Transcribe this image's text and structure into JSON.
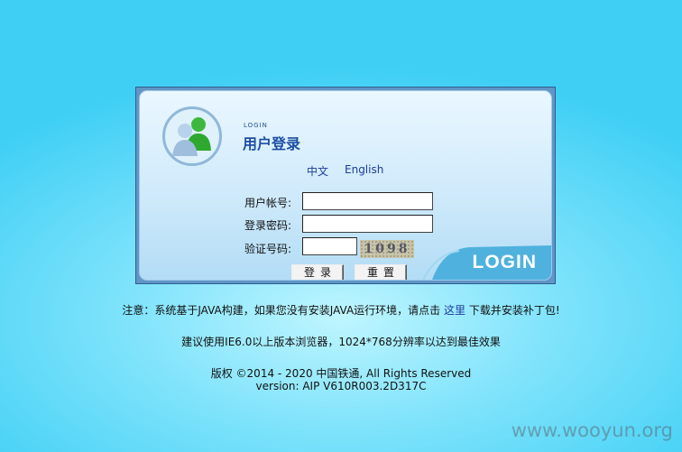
{
  "panel": {
    "login_small": "LOGIN",
    "title": "用户登录",
    "lang_zh": "中文",
    "lang_en": "English",
    "fields": {
      "username_label": "用户帐号:",
      "password_label": "登录密码:",
      "captcha_label": "验证号码:",
      "username_value": "",
      "password_value": "",
      "captcha_value": ""
    },
    "captcha_text": "1098",
    "login_button": "登录",
    "reset_button": "重置",
    "corner_text": "LOGIN"
  },
  "notice": {
    "prefix": "注意：系统基于JAVA构建，如果您没有安装JAVA运行环境，请点击",
    "link": "这里",
    "suffix": "下载并安装补丁包!"
  },
  "recommend": "建议使用IE6.0以上版本浏览器，1024*768分辨率以达到最佳效果",
  "copyright": "版权 ©2014 - 2020 中国铁通, All Rights Reserved",
  "version": "version: AIP V610R003.2D317C",
  "watermark": "www.wooyun.org",
  "colors": {
    "accent": "#1d4fa3",
    "background": "#3fcff5"
  },
  "icons": {
    "avatar": "users-icon"
  }
}
